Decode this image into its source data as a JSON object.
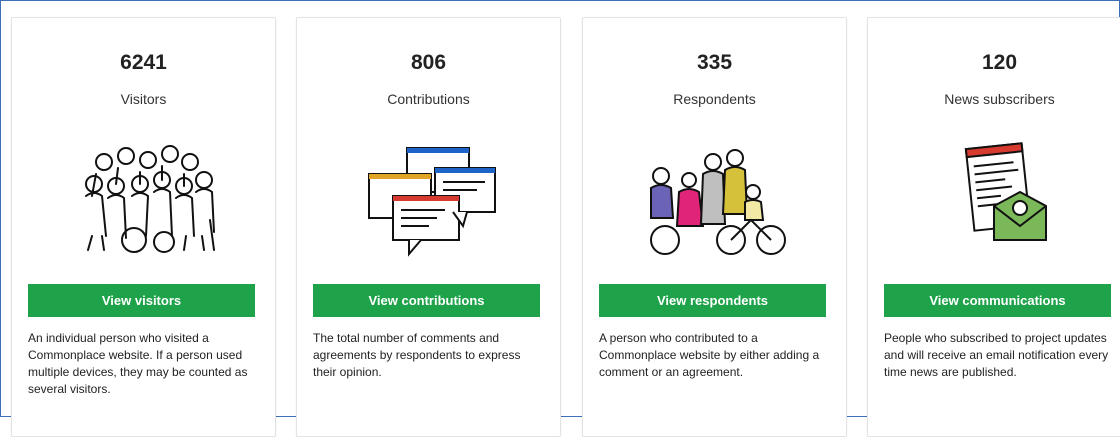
{
  "cards": [
    {
      "count": "6241",
      "label": "Visitors",
      "button_label": "View visitors",
      "description": "An individual person who visited a Commonplace website. If a person used multiple devices, they may be counted as several visitors.",
      "illustration": "crowd-of-people-icon"
    },
    {
      "count": "806",
      "label": "Contributions",
      "button_label": "View contributions",
      "description": "The total number of comments and agreements by respondents to express their opinion.",
      "illustration": "comment-windows-icon"
    },
    {
      "count": "335",
      "label": "Respondents",
      "button_label": "View respondents",
      "description": "A person who contributed to a Commonplace website by either adding a comment or an agreement.",
      "illustration": "colored-people-icon"
    },
    {
      "count": "120",
      "label": "News subscribers",
      "button_label": "View communications",
      "description": "People who subscribed to project updates and will receive an email notification every time news are published.",
      "illustration": "newsletter-envelope-icon"
    }
  ],
  "colors": {
    "button": "#1ea24a",
    "frame_border": "#3c6fb6"
  }
}
